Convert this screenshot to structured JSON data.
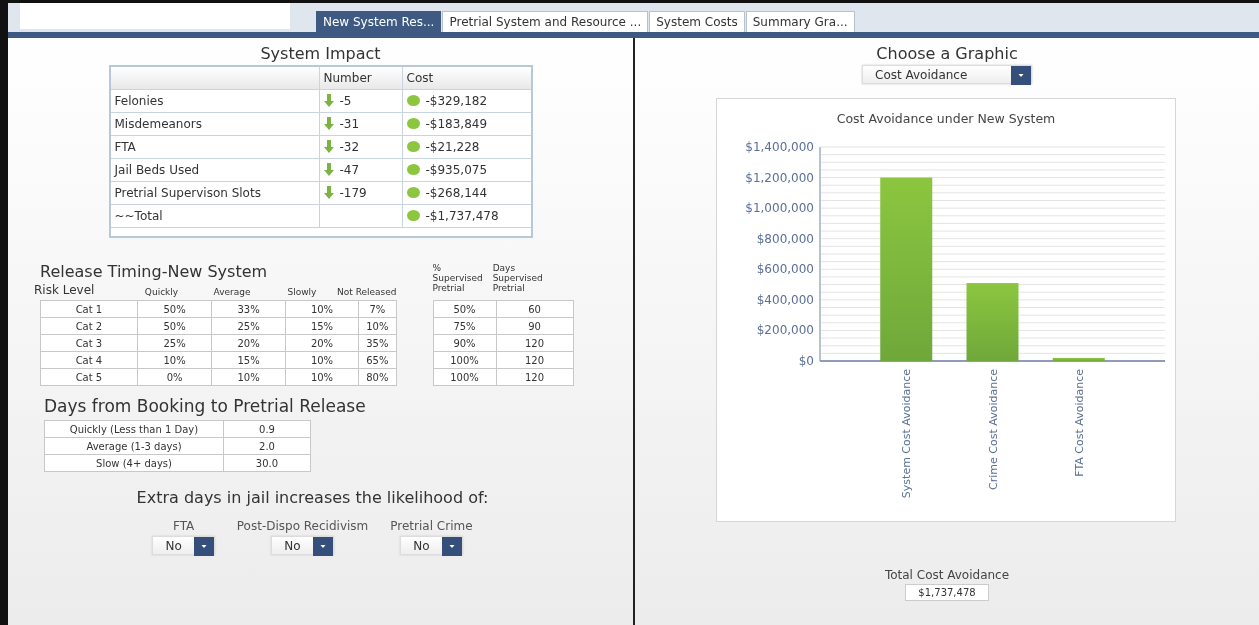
{
  "tabs": [
    {
      "label": "New System Res...",
      "selected": true
    },
    {
      "label": "Pretrial System and Resource ...",
      "selected": false
    },
    {
      "label": "System Costs",
      "selected": false
    },
    {
      "label": "Summary Gra...",
      "selected": false
    }
  ],
  "system_impact": {
    "title": "System Impact",
    "columns": [
      "Number",
      "Cost"
    ],
    "rows": [
      {
        "label": "Felonies",
        "number": "-5",
        "cost": "-$329,182"
      },
      {
        "label": "Misdemeanors",
        "number": "-31",
        "cost": "-$183,849"
      },
      {
        "label": "FTA",
        "number": "-32",
        "cost": "-$21,228"
      },
      {
        "label": "Jail Beds Used",
        "number": "-47",
        "cost": "-$935,075"
      },
      {
        "label": "Pretrial Supervison Slots",
        "number": "-179",
        "cost": "-$268,144"
      },
      {
        "label": "~~Total",
        "cost": "-$1,737,478"
      }
    ]
  },
  "release_timing": {
    "title": "Release Timing-New System",
    "columns": [
      "Risk Level",
      "Quickly",
      "Average",
      "Slowly",
      "Not Released"
    ],
    "rows": [
      [
        "Cat 1",
        "50%",
        "33%",
        "10%",
        "7%"
      ],
      [
        "Cat 2",
        "50%",
        "25%",
        "15%",
        "10%"
      ],
      [
        "Cat 3",
        "25%",
        "20%",
        "20%",
        "35%"
      ],
      [
        "Cat 4",
        "10%",
        "15%",
        "10%",
        "65%"
      ],
      [
        "Cat 5",
        "0%",
        "10%",
        "10%",
        "80%"
      ]
    ]
  },
  "supervision": {
    "columns": [
      "% Supervised Pretrial",
      "Days Supervised Pretrial"
    ],
    "rows": [
      [
        "50%",
        "60"
      ],
      [
        "75%",
        "90"
      ],
      [
        "90%",
        "120"
      ],
      [
        "100%",
        "120"
      ],
      [
        "100%",
        "120"
      ]
    ]
  },
  "booking_days": {
    "title": "Days from Booking to Pretrial Release",
    "rows": [
      [
        "Quickly (Less than 1 Day)",
        "0.9"
      ],
      [
        "Average (1-3 days)",
        "2.0"
      ],
      [
        "Slow (4+ days)",
        "30.0"
      ]
    ]
  },
  "likelihood": {
    "title": "Extra days in jail increases the likelihood of:",
    "selects": [
      {
        "label": "FTA",
        "value": "No"
      },
      {
        "label": "Post-Dispo Recidivism",
        "value": "No"
      },
      {
        "label": "Pretrial Crime",
        "value": "No"
      }
    ]
  },
  "graphic": {
    "title": "Choose a Graphic",
    "selected": "Cost Avoidance",
    "chart_data": {
      "type": "bar",
      "title": "Cost Avoidance under New System",
      "categories": [
        "System Cost Avoidance",
        "Crime Cost Avoidance",
        "FTA Cost Avoidance"
      ],
      "values": [
        1200000,
        510000,
        20000
      ],
      "grid": true,
      "ylim": [
        0,
        1400000
      ],
      "yticks": [
        {
          "value": 0,
          "label": "$0"
        },
        {
          "value": 200000,
          "label": "$200,000"
        },
        {
          "value": 400000,
          "label": "$400,000"
        },
        {
          "value": 600000,
          "label": "$600,000"
        },
        {
          "value": 800000,
          "label": "$800,000"
        },
        {
          "value": 1000000,
          "label": "$1,000,000"
        },
        {
          "value": 1200000,
          "label": "$1,200,000"
        },
        {
          "value": 1400000,
          "label": "$1,400,000"
        }
      ]
    },
    "total_label": "Total Cost Avoidance",
    "total_value": "$1,737,478"
  }
}
